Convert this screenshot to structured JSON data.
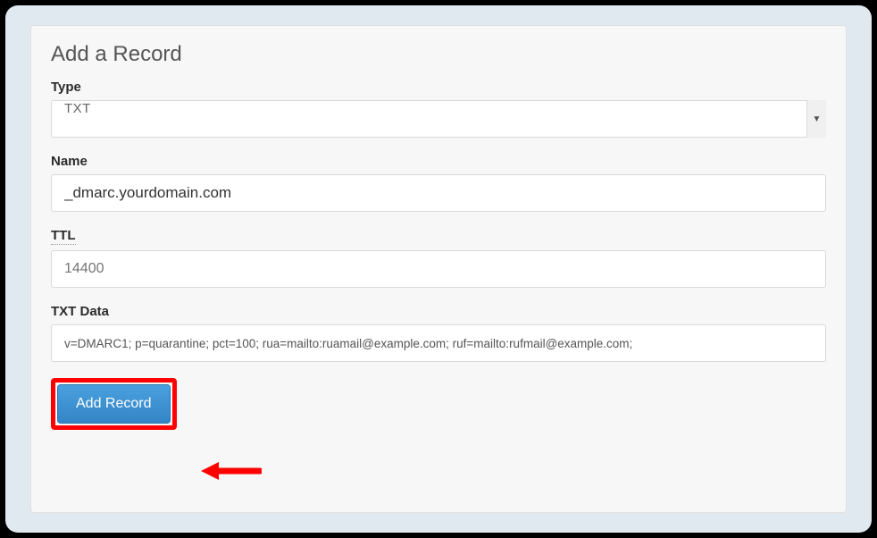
{
  "panel": {
    "title": "Add a Record"
  },
  "fields": {
    "type": {
      "label": "Type",
      "value": "TXT"
    },
    "name": {
      "label": "Name",
      "value": "_dmarc.yourdomain.com"
    },
    "ttl": {
      "label": "TTL",
      "placeholder": "14400"
    },
    "txtdata": {
      "label": "TXT Data",
      "value": "v=DMARC1; p=quarantine; pct=100; rua=mailto:ruamail@example.com; ruf=mailto:rufmail@example.com;"
    }
  },
  "actions": {
    "add_record": "Add Record"
  }
}
